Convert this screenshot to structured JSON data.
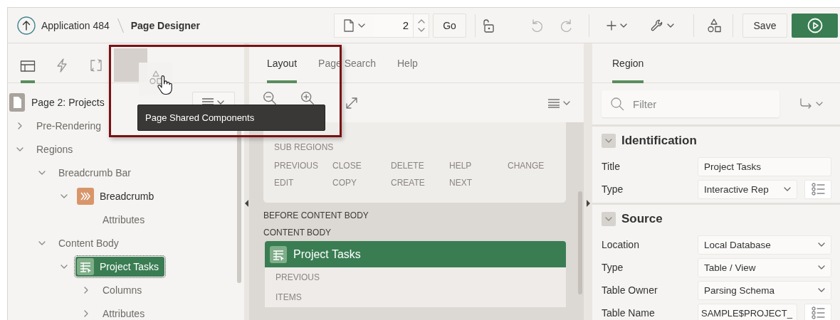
{
  "header": {
    "breadcrumb": [
      {
        "label": "Application 484",
        "kind": "link"
      },
      {
        "label": "Page Designer",
        "kind": "current"
      }
    ],
    "page_number": "2",
    "go_button": "Go",
    "undo": {
      "disabled": true
    },
    "redo": {
      "disabled": true
    },
    "save_button": "Save"
  },
  "left_panel": {
    "tabs": [
      {
        "kind": "rendering",
        "selected": true
      },
      {
        "kind": "dynamic-actions",
        "selected": false
      },
      {
        "kind": "processing",
        "selected": false
      }
    ],
    "tree": {
      "root": "Page 2: Projects",
      "items": [
        {
          "label": "Pre-Rendering",
          "kind": "group",
          "expanded": false,
          "selected": false
        },
        {
          "label": "Regions",
          "kind": "group",
          "expanded": true,
          "selected": false,
          "children": [
            {
              "label": "Breadcrumb Bar",
              "kind": "group",
              "expanded": true,
              "selected": false,
              "children": [
                {
                  "label": "Breadcrumb",
                  "kind": "breadcrumb",
                  "expanded": true,
                  "selected": false,
                  "children": [
                    {
                      "label": "Attributes",
                      "kind": "group",
                      "selected": false
                    }
                  ]
                }
              ]
            },
            {
              "label": "Content Body",
              "kind": "group",
              "expanded": true,
              "selected": false,
              "children": [
                {
                  "label": "Project Tasks",
                  "kind": "report",
                  "expanded": true,
                  "selected": true,
                  "children": [
                    {
                      "label": "Columns",
                      "kind": "group",
                      "expanded": false,
                      "selected": false
                    },
                    {
                      "label": "Attributes",
                      "kind": "group",
                      "expanded": false,
                      "selected": false
                    }
                  ]
                }
              ]
            }
          ]
        }
      ]
    }
  },
  "tooltip": "Page Shared Components",
  "layout_panel": {
    "tabs": [
      {
        "label": "Layout",
        "selected": true
      },
      {
        "label": "Page Search",
        "selected": false
      },
      {
        "label": "Help",
        "selected": false
      }
    ],
    "canvas": {
      "sub_regions": "SUB REGIONS",
      "button_positions": [
        [
          "PREVIOUS",
          "CLOSE",
          "DELETE",
          "HELP",
          "CHANGE"
        ],
        [
          "EDIT",
          "COPY",
          "CREATE",
          "NEXT"
        ]
      ],
      "before_content_body": "BEFORE CONTENT BODY",
      "content_body": "CONTENT BODY",
      "region": {
        "title": "Project Tasks",
        "positions": [
          "PREVIOUS",
          "ITEMS"
        ]
      }
    }
  },
  "property_panel": {
    "tabs": [
      {
        "label": "Region",
        "selected": true
      }
    ],
    "filter": {
      "placeholder": "Filter"
    },
    "sections": [
      {
        "title": "Identification",
        "expanded": true,
        "properties": [
          {
            "label": "Title",
            "value": "Project Tasks",
            "kind": "text"
          },
          {
            "label": "Type",
            "value": "Interactive Rep",
            "kind": "select-list"
          }
        ]
      },
      {
        "title": "Source",
        "expanded": true,
        "properties": [
          {
            "label": "Location",
            "value": "Local Database",
            "kind": "select"
          },
          {
            "label": "Type",
            "value": "Table / View",
            "kind": "select"
          },
          {
            "label": "Table Owner",
            "value": "Parsing Schema",
            "kind": "select"
          },
          {
            "label": "Table Name",
            "value": "SAMPLE$PROJECT_",
            "kind": "text-list"
          }
        ]
      }
    ]
  }
}
